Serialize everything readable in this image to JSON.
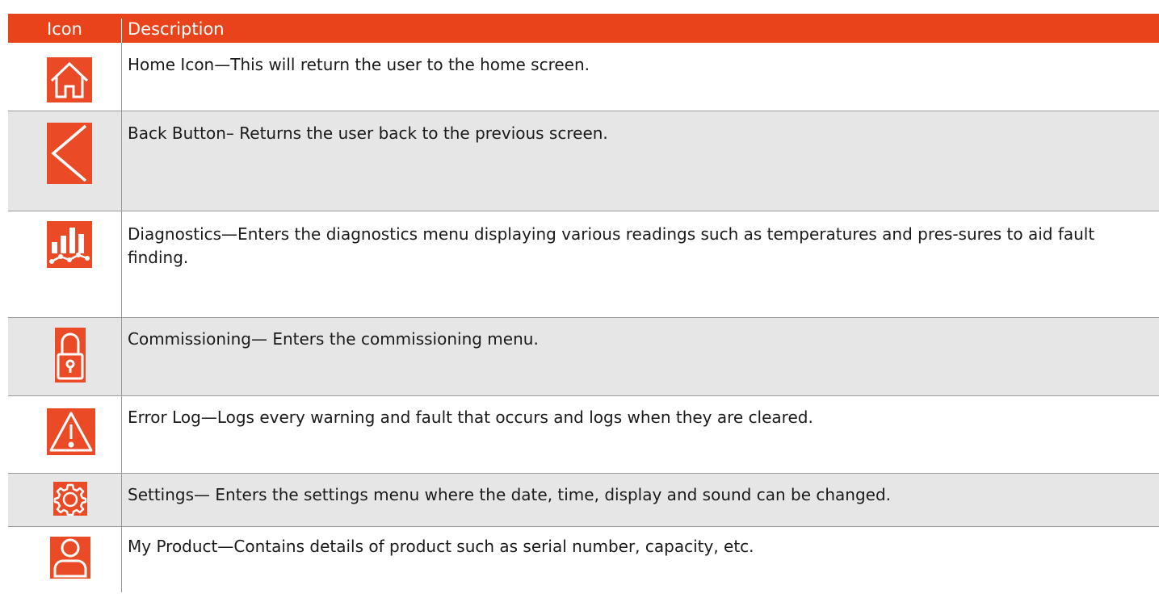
{
  "header": {
    "icon_col": "Icon",
    "desc_col": "Description"
  },
  "colors": {
    "header_bg": "#e8431a",
    "icon_bg": "#ea4a26",
    "alt_row": "#e6e6e6"
  },
  "rows": [
    {
      "icon": "home-icon",
      "text": "Home Icon—This will return the user to the home screen."
    },
    {
      "icon": "back-arrow-icon",
      "text": "Back Button– Returns the user back to the previous screen."
    },
    {
      "icon": "diagnostics-chart-icon",
      "text": "Diagnostics—Enters the diagnostics menu displaying various readings such as temperatures and pres-sures to aid fault finding."
    },
    {
      "icon": "padlock-icon",
      "text": "Commissioning— Enters the commissioning menu."
    },
    {
      "icon": "warning-icon",
      "text": "Error Log—Logs every warning and fault that occurs and logs when they are cleared."
    },
    {
      "icon": "gear-icon",
      "text": "Settings— Enters the settings menu where the date, time, display and sound can be changed."
    },
    {
      "icon": "user-icon",
      "text": "My Product—Contains details of product such as serial number, capacity, etc."
    }
  ]
}
